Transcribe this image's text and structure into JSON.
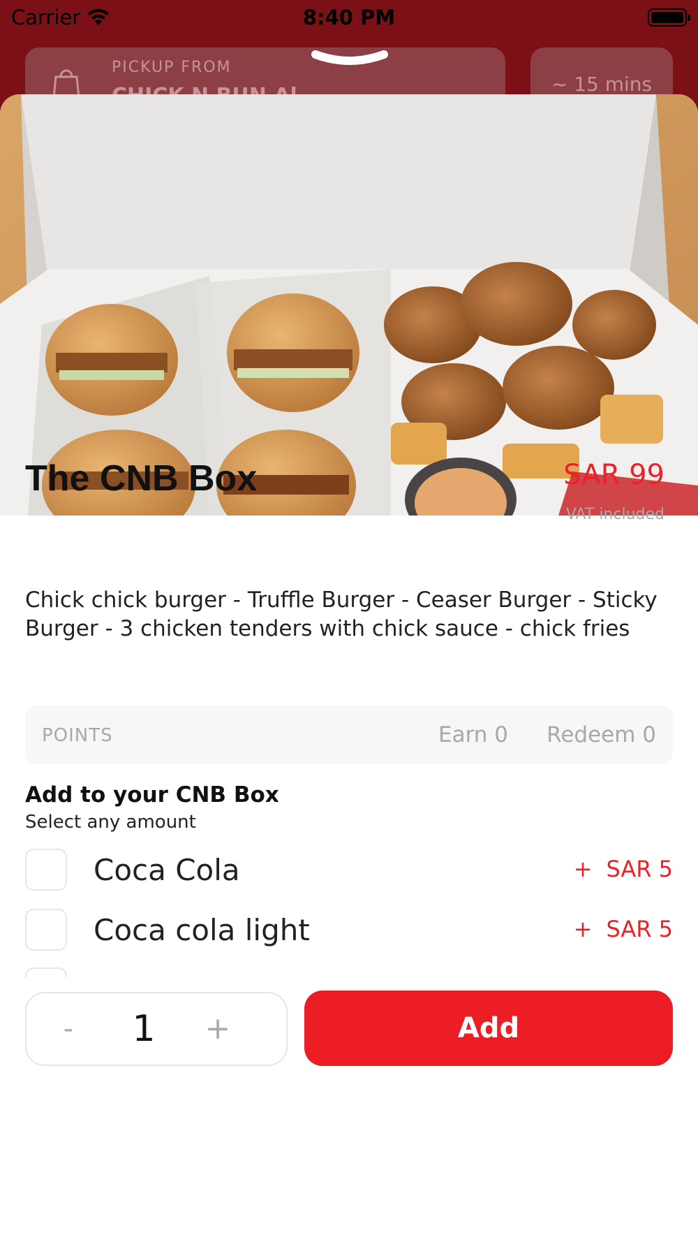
{
  "status_bar": {
    "carrier": "Carrier",
    "time": "8:40 PM"
  },
  "background": {
    "pickup_label": "PICKUP FROM",
    "pickup_name": "CHICK N BUN Al...",
    "time_estimate": "~ 15 mins"
  },
  "product": {
    "title": "The CNB Box",
    "price": "SAR 99",
    "vat_note": "VAT included",
    "description": "Chick chick burger - Truffle Burger - Ceaser Burger - Sticky Burger - 3 chicken tenders with chick sauce - chick fries"
  },
  "points": {
    "label": "POINTS",
    "earn": "Earn 0",
    "redeem": "Redeem 0"
  },
  "addons": {
    "heading": "Add to your CNB Box",
    "subheading": "Select any amount",
    "options": [
      {
        "name": "Coca Cola",
        "plus": "+",
        "price": "SAR 5"
      },
      {
        "name": "Coca cola light",
        "plus": "+",
        "price": "SAR 5"
      }
    ]
  },
  "quantity": {
    "minus": "-",
    "value": "1",
    "plus": "+"
  },
  "add_button": {
    "label": "Add"
  },
  "colors": {
    "brand_red": "#EC1D25",
    "overlay": "#7B1117"
  },
  "icons": [
    "wifi-icon",
    "battery-icon",
    "pickup-bag-icon",
    "chevron-down-icon",
    "food-photo"
  ]
}
